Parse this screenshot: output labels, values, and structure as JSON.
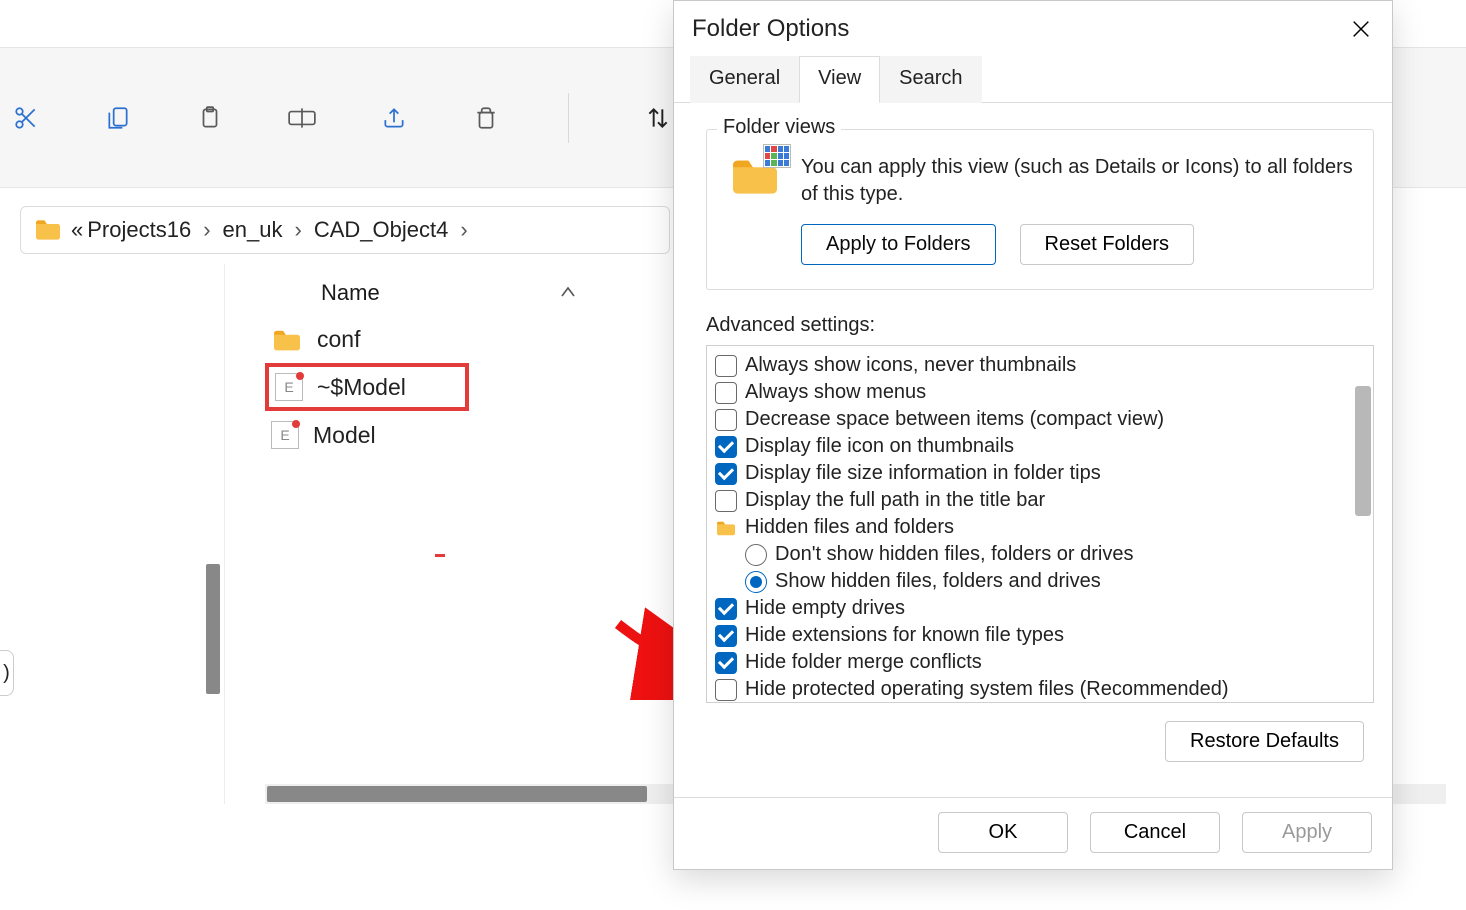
{
  "explorer": {
    "sort_label": "Sort",
    "breadcrumb": {
      "prefix": "«",
      "items": [
        "Projects16",
        "en_uk",
        "CAD_Object4"
      ]
    },
    "column_header": "Name",
    "files": [
      {
        "name": "conf",
        "type": "folder"
      },
      {
        "name": "~$Model",
        "type": "cad",
        "highlight": true
      },
      {
        "name": "Model",
        "type": "cad"
      }
    ],
    "side_handle": ")"
  },
  "dialog": {
    "title": "Folder Options",
    "tabs": {
      "general": "General",
      "view": "View",
      "search": "Search"
    },
    "folder_views": {
      "legend": "Folder views",
      "text": "You can apply this view (such as Details or Icons) to all folders of this type.",
      "apply": "Apply to Folders",
      "reset": "Reset Folders"
    },
    "advanced_label": "Advanced settings:",
    "settings": [
      {
        "kind": "checkbox",
        "checked": false,
        "label": "Always show icons, never thumbnails"
      },
      {
        "kind": "checkbox",
        "checked": false,
        "label": "Always show menus"
      },
      {
        "kind": "checkbox",
        "checked": false,
        "label": "Decrease space between items (compact view)"
      },
      {
        "kind": "checkbox",
        "checked": true,
        "label": "Display file icon on thumbnails"
      },
      {
        "kind": "checkbox",
        "checked": true,
        "label": "Display file size information in folder tips"
      },
      {
        "kind": "checkbox",
        "checked": false,
        "label": "Display the full path in the title bar"
      },
      {
        "kind": "folder",
        "label": "Hidden files and folders"
      },
      {
        "kind": "radio",
        "selected": false,
        "indent": true,
        "label": "Don't show hidden files, folders or drives"
      },
      {
        "kind": "radio",
        "selected": true,
        "indent": true,
        "label": "Show hidden files, folders and drives"
      },
      {
        "kind": "checkbox",
        "checked": true,
        "label": "Hide empty drives"
      },
      {
        "kind": "checkbox",
        "checked": true,
        "label": "Hide extensions for known file types"
      },
      {
        "kind": "checkbox",
        "checked": true,
        "label": "Hide folder merge conflicts"
      },
      {
        "kind": "checkbox",
        "checked": false,
        "label": "Hide protected operating system files (Recommended)"
      }
    ],
    "restore_defaults": "Restore Defaults",
    "buttons": {
      "ok": "OK",
      "cancel": "Cancel",
      "apply": "Apply"
    }
  }
}
